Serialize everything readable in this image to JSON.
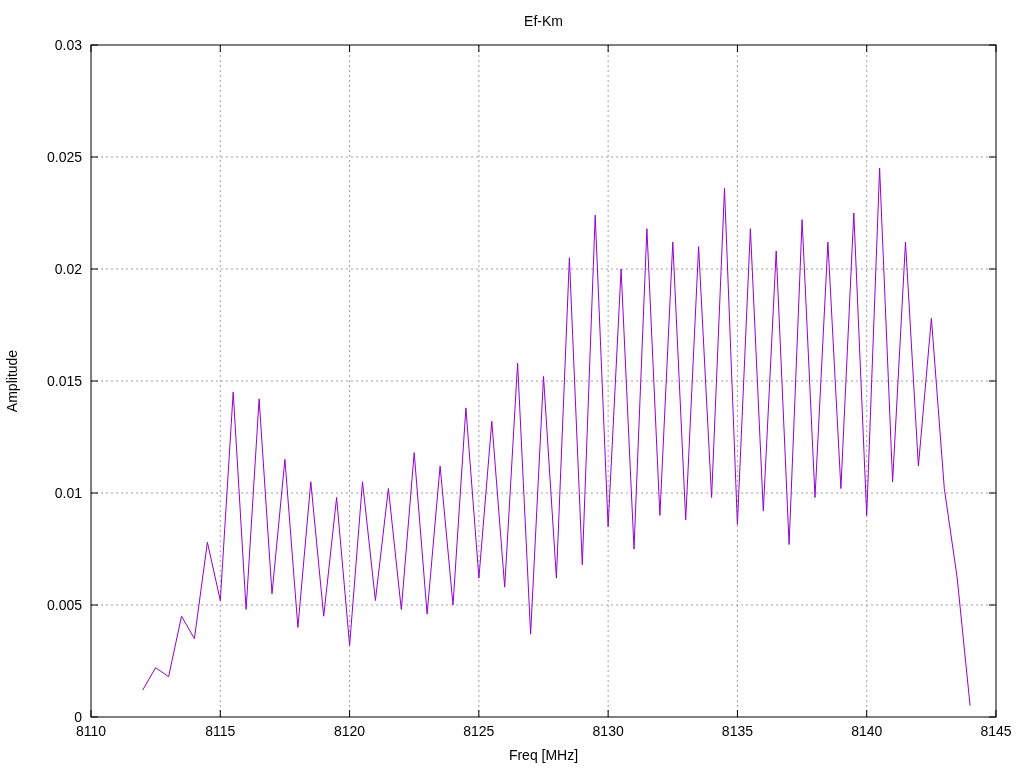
{
  "chart_data": {
    "type": "line",
    "title": "Ef-Km",
    "xlabel": "Freq [MHz]",
    "ylabel": "Amplitude",
    "grid": true,
    "xlim": [
      8110,
      8145
    ],
    "ylim": [
      0,
      0.03
    ],
    "xticks": [
      8110,
      8115,
      8120,
      8125,
      8130,
      8135,
      8140,
      8145
    ],
    "yticks": [
      0,
      0.005,
      0.01,
      0.015,
      0.02,
      0.025,
      0.03
    ],
    "x": [
      8112,
      8112.5,
      8113,
      8113.5,
      8114,
      8114.5,
      8115,
      8115.5,
      8116,
      8116.5,
      8117,
      8117.5,
      8118,
      8118.5,
      8119,
      8119.5,
      8120,
      8120.5,
      8121,
      8121.5,
      8122,
      8122.5,
      8123,
      8123.5,
      8124,
      8124.5,
      8125,
      8125.5,
      8126,
      8126.5,
      8127,
      8127.5,
      8128,
      8128.5,
      8129,
      8129.5,
      8130,
      8130.5,
      8131,
      8131.5,
      8132,
      8132.5,
      8133,
      8133.5,
      8134,
      8134.5,
      8135,
      8135.5,
      8136,
      8136.5,
      8137,
      8137.5,
      8138,
      8138.5,
      8139,
      8139.5,
      8140,
      8140.5,
      8141,
      8141.5,
      8142,
      8142.5,
      8143,
      8143.5,
      8144
    ],
    "series": [
      {
        "color": "#9400d3",
        "values": [
          0.0012,
          0.0022,
          0.0018,
          0.0045,
          0.0035,
          0.0078,
          0.0052,
          0.0145,
          0.0048,
          0.0142,
          0.0055,
          0.0115,
          0.004,
          0.0105,
          0.0045,
          0.0098,
          0.0032,
          0.0105,
          0.0052,
          0.0102,
          0.0048,
          0.0118,
          0.0046,
          0.0112,
          0.005,
          0.0138,
          0.0062,
          0.0132,
          0.0058,
          0.0158,
          0.0037,
          0.0152,
          0.0062,
          0.0205,
          0.0068,
          0.0224,
          0.0085,
          0.02,
          0.0075,
          0.0218,
          0.009,
          0.0212,
          0.0088,
          0.021,
          0.0098,
          0.0236,
          0.0086,
          0.0218,
          0.0092,
          0.0208,
          0.0077,
          0.0222,
          0.0098,
          0.0212,
          0.0102,
          0.0225,
          0.009,
          0.0245,
          0.0105,
          0.0212,
          0.0112,
          0.0178,
          0.0102,
          0.0062,
          0.0005
        ]
      }
    ]
  }
}
